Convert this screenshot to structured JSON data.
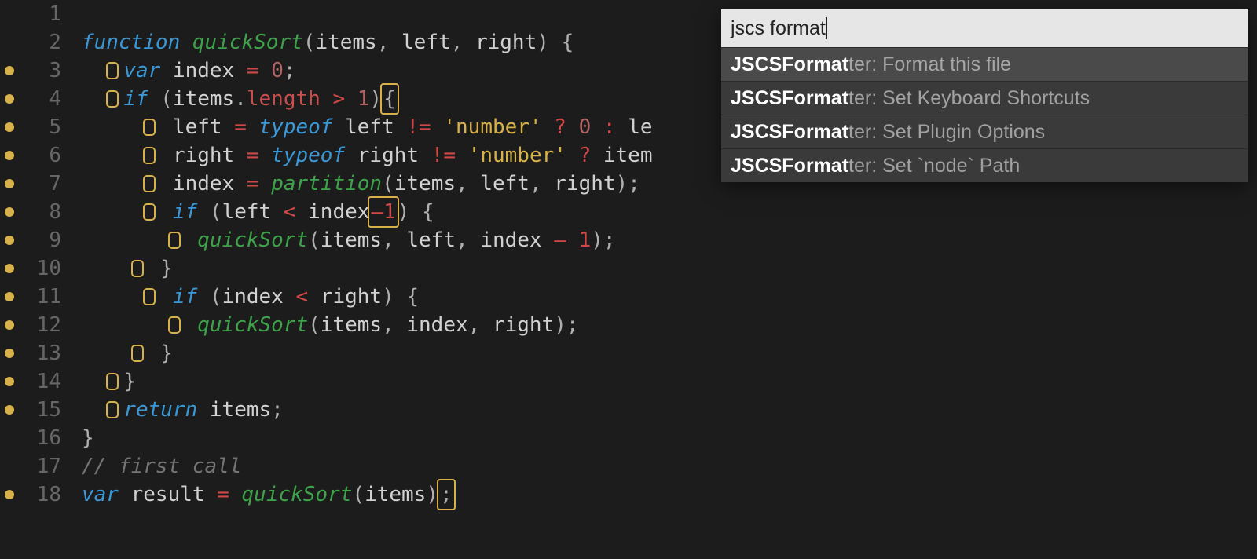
{
  "editor": {
    "lines": 18,
    "modified": [
      3,
      4,
      5,
      6,
      7,
      8,
      9,
      10,
      11,
      12,
      13,
      14,
      15,
      18
    ],
    "code": {
      "fn": "function",
      "qs": "quickSort",
      "items": "items",
      "left": "left",
      "right": "right",
      "var": "var",
      "index": "index",
      "eq": "=",
      "zero": "0",
      "semi": ";",
      "if": "if",
      "dot": ".",
      "length": "length",
      "gt": ">",
      "one": "1",
      "lbrace": "{",
      "rbrace": "}",
      "typeof": "typeof",
      "neq": "!=",
      "numstr": "'number'",
      "q": "?",
      "colon": ":",
      "le": "le",
      "item": "item",
      "partition": "partition",
      "comma": ",",
      "lt": "<",
      "minus": "–",
      "minus2": "-",
      "return": "return",
      "comment": "// first call",
      "result": "result",
      "lp": "(",
      "rp": ")"
    }
  },
  "palette": {
    "query": "jscs format",
    "items": [
      {
        "match": "JSCSFormat",
        "rest": "ter: Format this file",
        "selected": true
      },
      {
        "match": "JSCSFormat",
        "rest": "ter: Set Keyboard Shortcuts",
        "selected": false
      },
      {
        "match": "JSCSFormat",
        "rest": "ter: Set Plugin Options",
        "selected": false
      },
      {
        "match": "JSCSFormat",
        "rest": "ter: Set `node` Path",
        "selected": false
      }
    ]
  }
}
